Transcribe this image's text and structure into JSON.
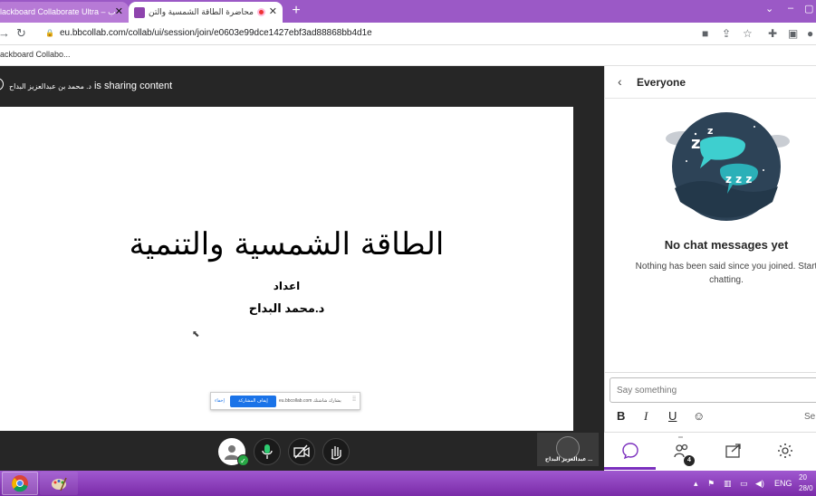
{
  "browser": {
    "tabs": [
      {
        "title": "lackboard Collaborate Ultra – ب",
        "active": false,
        "close": "✕"
      },
      {
        "title": "محاضرة الطاقة الشمسية والتن",
        "active": true,
        "close": "✕"
      }
    ],
    "new_tab": "+",
    "url": "eu.bbcollab.com/collab/ui/session/join/e0603e99dce1427ebf3ad88868bb4d1e",
    "bookmark": "ackboard Collabo...",
    "window_controls": {
      "minimize": "–",
      "restore": "▢"
    }
  },
  "session": {
    "sharer_name": "د. محمد بن عبدالعزيز البداح",
    "sharing_text": "is sharing content",
    "slide": {
      "title": "الطاقة الشمسية والتنمية",
      "by_label": "اعداد",
      "author": "د.محمد البداح"
    },
    "share_bar": {
      "grip": "⁞⁞",
      "message": "يشارك شاشتك eu.bbcollab.com",
      "stop_button": "إيقاف المشاركة",
      "hide_button": "إخفاء"
    },
    "participant_tile_name": "عبدالعزيز البداح ..."
  },
  "chat": {
    "channel": "Everyone",
    "empty_title": "No chat messages yet",
    "empty_subtitle": "Nothing has been said since you joined. Start chatting.",
    "input_placeholder": "Say something",
    "format": {
      "bold": "B",
      "italic": "I",
      "underline": "U",
      "send_partial": "Se"
    },
    "attendees_count": "4"
  },
  "taskbar": {
    "language": "ENG",
    "clock_time": "20",
    "clock_date": "28/0"
  },
  "colors": {
    "accent": "#7b2fbe",
    "tabbar": "#9b59c6",
    "session_bg": "#262626",
    "stop_button": "#1a73e8"
  }
}
